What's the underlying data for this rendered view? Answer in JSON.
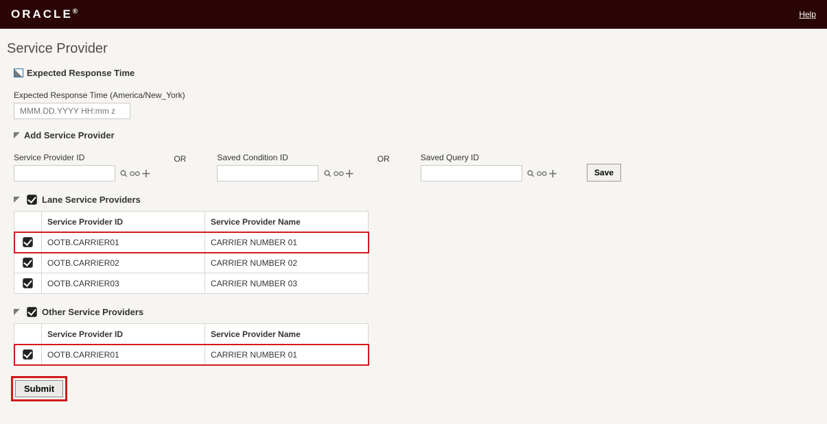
{
  "header": {
    "logo_text": "ORACLE",
    "help_label": "Help"
  },
  "page": {
    "title": "Service Provider"
  },
  "expected_response": {
    "section_label": "Expected Response Time",
    "field_label": "Expected Response Time (America/New_York)",
    "placeholder": "MMM.DD.YYYY HH:mm z"
  },
  "add_sp": {
    "section_label": "Add Service Provider",
    "sp_id_label": "Service Provider ID",
    "saved_condition_label": "Saved Condition ID",
    "saved_query_label": "Saved Query ID",
    "or_label": "OR",
    "save_label": "Save"
  },
  "lane": {
    "section_label": "Lane Service Providers",
    "col_id": "Service Provider ID",
    "col_name": "Service Provider Name",
    "rows": [
      {
        "id": "OOTB.CARRIER01",
        "name": "CARRIER NUMBER 01",
        "highlight": true
      },
      {
        "id": "OOTB.CARRIER02",
        "name": "CARRIER NUMBER 02",
        "highlight": false
      },
      {
        "id": "OOTB.CARRIER03",
        "name": "CARRIER NUMBER 03",
        "highlight": false
      }
    ]
  },
  "other": {
    "section_label": "Other Service Providers",
    "col_id": "Service Provider ID",
    "col_name": "Service Provider Name",
    "rows": [
      {
        "id": "OOTB.CARRIER01",
        "name": "CARRIER NUMBER 01",
        "highlight": true
      }
    ]
  },
  "footer": {
    "submit_label": "Submit"
  }
}
